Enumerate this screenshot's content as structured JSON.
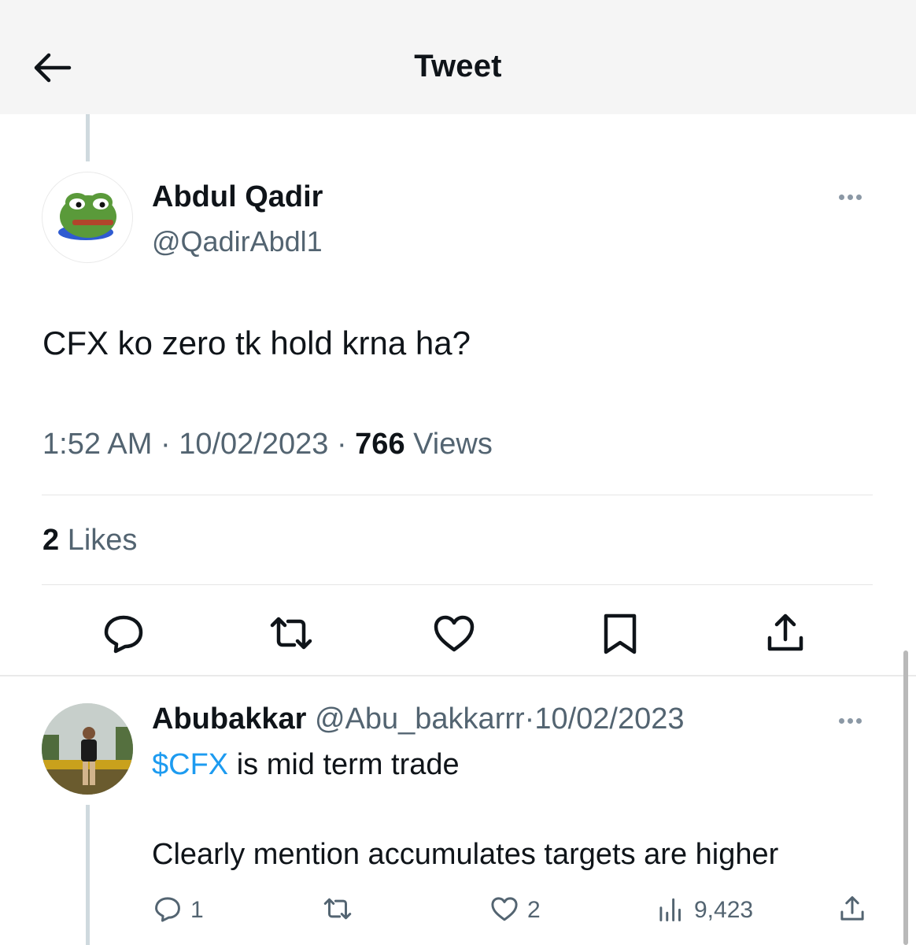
{
  "header": {
    "title": "Tweet"
  },
  "tweet": {
    "author_name": "Abdul Qadir",
    "author_handle": "@QadirAbdl1",
    "text": "CFX ko zero tk hold krna ha?",
    "time": "1:52 AM",
    "separator": "·",
    "date": "10/02/2023",
    "views_count": "766",
    "views_label": "Views",
    "likes_count": "2",
    "likes_label": "Likes"
  },
  "reply": {
    "author_name": "Abubakkar",
    "author_handle": "@Abu_bakkarrr",
    "separator": "·",
    "date": "10/02/2023",
    "cashtag": "$CFX",
    "text_line1_rest": " is mid term trade",
    "text_line2": "Clearly mention accumulates targets are higher",
    "stats": {
      "replies": "1",
      "likes": "2",
      "views": "9,423"
    }
  },
  "icons": [
    "back-arrow-icon",
    "more-icon",
    "reply-icon",
    "retweet-icon",
    "like-icon",
    "bookmark-icon",
    "share-icon",
    "views-icon"
  ],
  "colors": {
    "link": "#1d9bf0",
    "muted": "#536471",
    "text": "#0f1419"
  }
}
